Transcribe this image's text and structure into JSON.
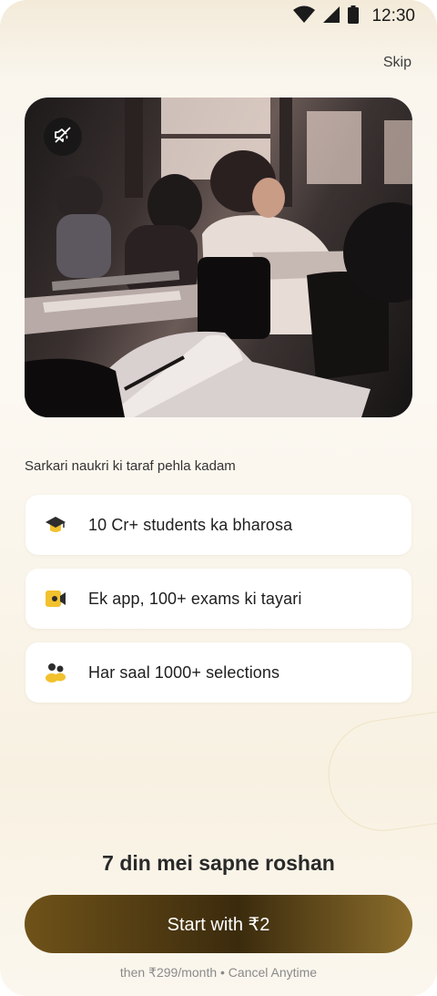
{
  "status_bar": {
    "time": "12:30"
  },
  "header": {
    "skip_label": "Skip"
  },
  "media": {
    "mute_icon": "speaker-muted-icon"
  },
  "tagline": "Sarkari naukri ki taraf pehla kadam",
  "features": [
    {
      "icon": "graduation-cap-icon",
      "label": "10 Cr+ students ka bharosa"
    },
    {
      "icon": "video-camera-icon",
      "label": "Ek app, 100+ exams ki tayari"
    },
    {
      "icon": "people-icon",
      "label": "Har saal 1000+ selections"
    }
  ],
  "headline": "7 din mei sapne roshan",
  "cta": {
    "label": "Start with ₹2"
  },
  "fine_print": "then ₹299/month • Cancel Anytime",
  "colors": {
    "accent_gold": "#f2c12e",
    "cta_dark": "#3b2b0d",
    "cta_gold": "#8b6d2c"
  }
}
